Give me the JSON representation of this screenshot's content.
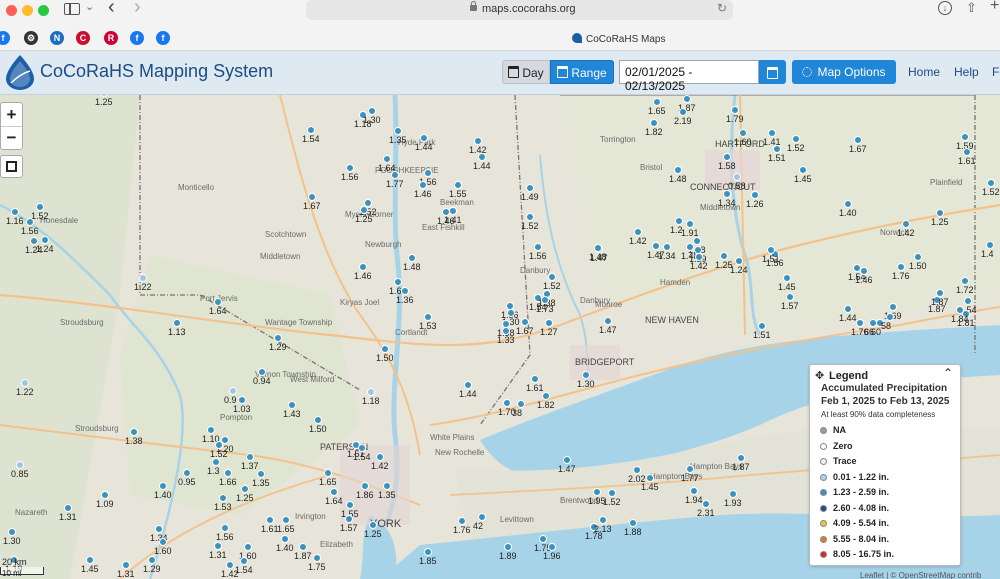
{
  "browser": {
    "url": "maps.cocorahs.org",
    "tab_title": "CoCoRaHS Maps",
    "bookmarks": [
      {
        "icon": "facebook-icon",
        "glyph": "f",
        "color": "#1877f2"
      },
      {
        "icon": "gear-icon",
        "glyph": "⚙",
        "color": "#333333"
      },
      {
        "icon": "noaa-icon",
        "glyph": "N",
        "color": "#1b6ec2"
      },
      {
        "icon": "cummins-icon",
        "glyph": "C",
        "color": "#c8102e"
      },
      {
        "icon": "rutgers-icon",
        "glyph": "R",
        "color": "#cc0033"
      },
      {
        "icon": "facebook-icon",
        "glyph": "f",
        "color": "#1877f2"
      },
      {
        "icon": "facebook-icon",
        "glyph": "f",
        "color": "#1877f2"
      }
    ]
  },
  "header": {
    "title": "CoCoRaHS Mapping System",
    "day_label": "Day",
    "range_label": "Range",
    "date_range": "02/01/2025 - 02/13/2025",
    "map_options_label": "Map Options",
    "nav": [
      "Home",
      "Help",
      "Fo"
    ]
  },
  "map": {
    "zoom_in": "+",
    "zoom_out": "−",
    "scale_label": "20 km",
    "scale_label2": "10 mi",
    "attribution": "Leaflet | © OpenStreetMap contrib",
    "colors": {
      "low": "#9cc8e6",
      "mid": "#3a92bf",
      "high": "#1b4f86",
      "trace": "#ffffff",
      "zero": "#ffffff",
      "na": "#9a9a9a"
    },
    "stations": [
      {
        "v": "1.25",
        "c": "low"
      },
      {
        "v": "1.54",
        "c": "mid"
      },
      {
        "v": "1.18",
        "c": "mid"
      },
      {
        "v": "1.30",
        "c": "mid"
      },
      {
        "v": "1.35",
        "c": "mid"
      },
      {
        "v": "1.44",
        "c": "mid"
      },
      {
        "v": "1.42",
        "c": "mid"
      },
      {
        "v": "1.44",
        "c": "mid"
      },
      {
        "v": "1.56",
        "c": "mid"
      },
      {
        "v": "1.64",
        "c": "mid"
      },
      {
        "v": "1.77",
        "c": "mid"
      },
      {
        "v": "1.56",
        "c": "mid"
      },
      {
        "v": "1.46",
        "c": "mid"
      },
      {
        "v": "1.55",
        "c": "mid"
      },
      {
        "v": "1.46",
        "c": "mid"
      },
      {
        "v": "1.49",
        "c": "mid"
      },
      {
        "v": "1.67",
        "c": "mid"
      },
      {
        "v": "1.52",
        "c": "mid"
      },
      {
        "v": "1.25",
        "c": "mid"
      },
      {
        "v": "1.41",
        "c": "mid"
      },
      {
        "v": "1.52",
        "c": "mid"
      },
      {
        "v": "1.56",
        "c": "mid"
      },
      {
        "v": "1.24",
        "c": "mid"
      },
      {
        "v": "1.52",
        "c": "mid"
      },
      {
        "v": "1.48",
        "c": "mid"
      },
      {
        "v": "1.46",
        "c": "mid"
      },
      {
        "v": "1.52",
        "c": "mid"
      },
      {
        "v": "1.62",
        "c": "mid"
      },
      {
        "v": "1.36",
        "c": "mid"
      },
      {
        "v": "1.56",
        "c": "mid"
      },
      {
        "v": "1.54",
        "c": "mid"
      },
      {
        "v": "1.38",
        "c": "mid"
      },
      {
        "v": "1.22",
        "c": "low"
      },
      {
        "v": "1.64",
        "c": "mid"
      },
      {
        "v": "1.13",
        "c": "mid"
      },
      {
        "v": "1.53",
        "c": "mid"
      },
      {
        "v": "1.73",
        "c": "mid"
      },
      {
        "v": "1.30",
        "c": "mid"
      },
      {
        "v": "1.67",
        "c": "mid"
      },
      {
        "v": "1.27",
        "c": "mid"
      },
      {
        "v": "1.38",
        "c": "mid"
      },
      {
        "v": "1.33",
        "c": "mid"
      },
      {
        "v": "1.47",
        "c": "mid"
      },
      {
        "v": "1.29",
        "c": "mid"
      },
      {
        "v": "1.50",
        "c": "mid"
      },
      {
        "v": "0.94",
        "c": "mid"
      },
      {
        "v": "1.22",
        "c": "low"
      },
      {
        "v": "0.9",
        "c": "low"
      },
      {
        "v": "1.03",
        "c": "mid"
      },
      {
        "v": "1.43",
        "c": "mid"
      },
      {
        "v": "1.18",
        "c": "low"
      },
      {
        "v": "1.44",
        "c": "mid"
      },
      {
        "v": "1.61",
        "c": "mid"
      },
      {
        "v": "1.30",
        "c": "mid"
      },
      {
        "v": "1.70",
        "c": "mid"
      },
      {
        "v": "38",
        "c": "mid"
      },
      {
        "v": "1.82",
        "c": "mid"
      },
      {
        "v": "1.47",
        "c": "mid"
      },
      {
        "v": "1.30",
        "c": "mid"
      },
      {
        "v": "1.50",
        "c": "mid"
      },
      {
        "v": "1.10",
        "c": "mid"
      },
      {
        "v": "1.20",
        "c": "mid"
      },
      {
        "v": "1.38",
        "c": "mid"
      },
      {
        "v": "1.52",
        "c": "mid"
      },
      {
        "v": "1.51",
        "c": "mid"
      },
      {
        "v": "1.54",
        "c": "mid"
      },
      {
        "v": "1.42",
        "c": "mid"
      },
      {
        "v": "0.85",
        "c": "low"
      },
      {
        "v": "0.95",
        "c": "mid"
      },
      {
        "v": "1.40",
        "c": "mid"
      },
      {
        "v": "1.37",
        "c": "mid"
      },
      {
        "v": "1.35",
        "c": "mid"
      },
      {
        "v": "1.66",
        "c": "mid"
      },
      {
        "v": "1.3",
        "c": "mid"
      },
      {
        "v": "1.25",
        "c": "mid"
      },
      {
        "v": "1.65",
        "c": "mid"
      },
      {
        "v": "1.86",
        "c": "mid"
      },
      {
        "v": "1.35",
        "c": "mid"
      },
      {
        "v": "1.64",
        "c": "mid"
      },
      {
        "v": "1.09",
        "c": "mid"
      },
      {
        "v": "1.53",
        "c": "mid"
      },
      {
        "v": "1.55",
        "c": "mid"
      },
      {
        "v": "1.31",
        "c": "mid"
      },
      {
        "v": "1.61",
        "c": "mid"
      },
      {
        "v": "1.65",
        "c": "mid"
      },
      {
        "v": "1.57",
        "c": "mid"
      },
      {
        "v": "1.25",
        "c": "mid"
      },
      {
        "v": "1.34",
        "c": "mid"
      },
      {
        "v": "1.60",
        "c": "mid"
      },
      {
        "v": "1.56",
        "c": "mid"
      },
      {
        "v": "1.31",
        "c": "mid"
      },
      {
        "v": "1.60",
        "c": "mid"
      },
      {
        "v": "1.40",
        "c": "mid"
      },
      {
        "v": "1.87",
        "c": "mid"
      },
      {
        "v": "1.75",
        "c": "mid"
      },
      {
        "v": "1.19",
        "c": "mid"
      },
      {
        "v": "1.45",
        "c": "mid"
      },
      {
        "v": "1.31",
        "c": "mid"
      },
      {
        "v": "1.29",
        "c": "mid"
      },
      {
        "v": "1.42",
        "c": "mid"
      },
      {
        "v": "1.54",
        "c": "mid"
      },
      {
        "v": "1.85",
        "c": "mid"
      },
      {
        "v": "1.76",
        "c": "mid"
      },
      {
        "v": "42",
        "c": "mid"
      },
      {
        "v": "1.89",
        "c": "mid"
      },
      {
        "v": "1.75",
        "c": "mid"
      },
      {
        "v": "1.96",
        "c": "mid"
      },
      {
        "v": "1.95",
        "c": "mid"
      },
      {
        "v": "1.52",
        "c": "mid"
      },
      {
        "v": "1.78",
        "c": "mid"
      },
      {
        "v": "2.13",
        "c": "mid"
      },
      {
        "v": "1.88",
        "c": "mid"
      },
      {
        "v": "2.02",
        "c": "mid"
      },
      {
        "v": "1.45",
        "c": "mid"
      },
      {
        "v": "1.77",
        "c": "mid"
      },
      {
        "v": "1.94",
        "c": "mid"
      },
      {
        "v": "2.31",
        "c": "mid"
      },
      {
        "v": "1.93",
        "c": "mid"
      },
      {
        "v": "1.87",
        "c": "mid"
      },
      {
        "v": "1.87",
        "c": "mid"
      },
      {
        "v": "1.65",
        "c": "mid"
      },
      {
        "v": "2.19",
        "c": "mid"
      },
      {
        "v": "1.82",
        "c": "mid"
      },
      {
        "v": "1.79",
        "c": "mid"
      },
      {
        "v": "1.60",
        "c": "mid"
      },
      {
        "v": "1.41",
        "c": "mid"
      },
      {
        "v": "1.51",
        "c": "mid"
      },
      {
        "v": "1.52",
        "c": "mid"
      },
      {
        "v": "1.58",
        "c": "mid"
      },
      {
        "v": "1.48",
        "c": "mid"
      },
      {
        "v": "0.58",
        "c": "low"
      },
      {
        "v": "1.34",
        "c": "mid"
      },
      {
        "v": "1.26",
        "c": "mid"
      },
      {
        "v": "1.45",
        "c": "mid"
      },
      {
        "v": "1.67",
        "c": "mid"
      },
      {
        "v": "1.59",
        "c": "mid"
      },
      {
        "v": "1.61",
        "c": "mid"
      },
      {
        "v": "1.40",
        "c": "mid"
      },
      {
        "v": "1.25",
        "c": "mid"
      },
      {
        "v": "1.42",
        "c": "mid"
      },
      {
        "v": "1.2",
        "c": "mid"
      },
      {
        "v": "1.91",
        "c": "mid"
      },
      {
        "v": "1.42",
        "c": "mid"
      },
      {
        "v": "1.48",
        "c": "mid"
      },
      {
        "v": "1.47",
        "c": "mid"
      },
      {
        "v": "1.34",
        "c": "mid"
      },
      {
        "v": "1.48",
        "c": "mid"
      },
      {
        "v": "1.59",
        "c": "mid"
      },
      {
        "v": "1.42",
        "c": "mid"
      },
      {
        "v": "1.25",
        "c": "mid"
      },
      {
        "v": "1.24",
        "c": "mid"
      },
      {
        "v": "1.56",
        "c": "mid"
      },
      {
        "v": "1.51",
        "c": "mid"
      },
      {
        "v": "1.54",
        "c": "mid"
      },
      {
        "v": "1.46",
        "c": "mid"
      },
      {
        "v": "1.76",
        "c": "mid"
      },
      {
        "v": "1.50",
        "c": "mid"
      },
      {
        "v": "1.45",
        "c": "mid"
      },
      {
        "v": "1.57",
        "c": "mid"
      },
      {
        "v": "1.44",
        "c": "mid"
      },
      {
        "v": "1.51",
        "c": "mid"
      },
      {
        "v": "1.76",
        "c": "mid"
      },
      {
        "v": "66",
        "c": "mid"
      },
      {
        "v": "60",
        "c": "mid"
      },
      {
        "v": "1.69",
        "c": "mid"
      },
      {
        "v": "58",
        "c": "mid"
      },
      {
        "v": "1.87",
        "c": "mid"
      },
      {
        "v": "1.87",
        "c": "mid"
      },
      {
        "v": "1.72",
        "c": "mid"
      },
      {
        "v": "1.54",
        "c": "mid"
      },
      {
        "v": "1.81",
        "c": "mid"
      },
      {
        "v": "1.84",
        "c": "mid"
      },
      {
        "v": "1.4",
        "c": "mid"
      },
      {
        "v": "1.52",
        "c": "mid"
      },
      {
        "v": "1.16",
        "c": "mid"
      },
      {
        "v": "1.56",
        "c": "mid"
      },
      {
        "v": "1.24",
        "c": "mid"
      },
      {
        "v": "1.47",
        "c": "mid"
      },
      {
        "v": "1.48",
        "c": "mid"
      }
    ]
  },
  "legend": {
    "title": "Legend",
    "heading": "Accumulated Precipitation",
    "period": "Feb 1, 2025 to Feb 13, 2025",
    "note": "At least 90% data completeness",
    "items": [
      {
        "label": "NA",
        "color": "#9a9a9a"
      },
      {
        "label": "Zero",
        "color": "#ffffff"
      },
      {
        "label": "Trace",
        "color": "#f2f2f2"
      },
      {
        "label": "0.01 - 1.22 in.",
        "color": "#a9d3ef"
      },
      {
        "label": "1.23 - 2.59 in.",
        "color": "#3a92bf"
      },
      {
        "label": "2.60 - 4.08 in.",
        "color": "#1d4f8c"
      },
      {
        "label": "4.09 - 5.54 in.",
        "color": "#f0c23a"
      },
      {
        "label": "5.55 - 8.04 in.",
        "color": "#e07b28"
      },
      {
        "label": "8.05 - 16.75 in.",
        "color": "#d62728"
      }
    ]
  }
}
